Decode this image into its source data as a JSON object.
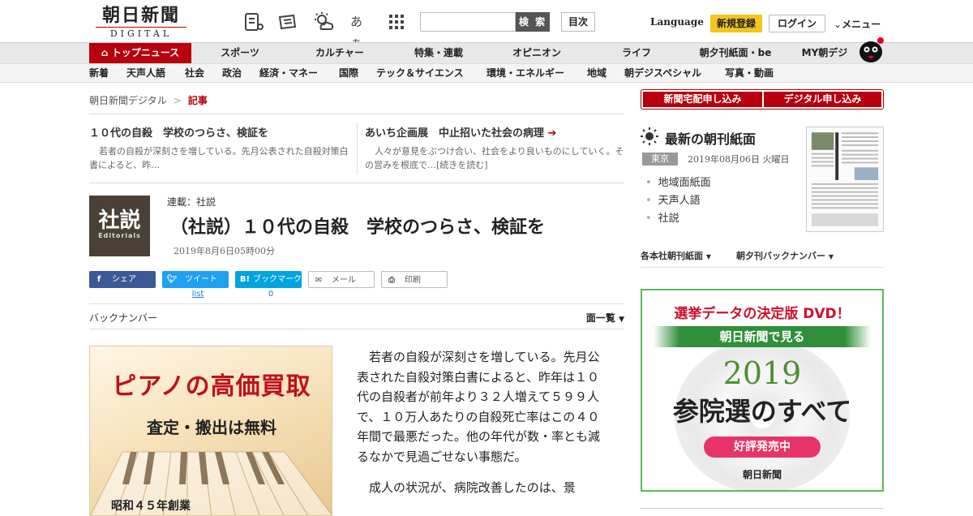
{
  "header": {
    "logo_jp": "朝日新聞",
    "logo_en": "DIGITAL",
    "font_size_label": "あぁ",
    "search_placeholder": "",
    "search_button": "検 索",
    "toc_button": "目次",
    "language": "Language",
    "register": "新規登録",
    "login": "ログイン",
    "menu": "メニュー"
  },
  "nav_primary": [
    {
      "label": "トップニュース",
      "active": true
    },
    {
      "label": "スポーツ"
    },
    {
      "label": "カルチャー"
    },
    {
      "label": "特集・連載"
    },
    {
      "label": "オピニオン"
    },
    {
      "label": "ライフ"
    },
    {
      "label": "朝夕刊紙面・be"
    },
    {
      "label": "MY朝デジ"
    }
  ],
  "nav_secondary": [
    "新着",
    "天声人語",
    "社会",
    "政治",
    "経済・マネー",
    "国際",
    "テック＆サイエンス",
    "環境・エネルギー",
    "地域",
    "朝デジスペシャル",
    "写真・動画"
  ],
  "breadcrumb": {
    "home": "朝日新聞デジタル",
    "sep": ">",
    "current": "記事"
  },
  "related": [
    {
      "title": "１０代の自殺　学校のつらさ、検証を",
      "desc": "若者の自殺が深刻さを増している。先月公表された自殺対策白書によると、昨…"
    },
    {
      "title": "あいち企画展　中止招いた社会の病理",
      "desc": "人々が意見をぶつけ合い、社会をより良いものにしていく。その営みを根底で…[続きを読む]"
    }
  ],
  "article": {
    "editorial_kanji": "社説",
    "editorial_en": "Editorials",
    "series": "連載：社説",
    "title": "（社説）１０代の自殺　学校のつらさ、検証を",
    "date": "2019年8月6日05時00分",
    "body": [
      "若者の自殺が深刻さを増している。先月公表された自殺対策白書によると、昨年は１０代の自殺者が前年より３２人増えて５９９人で、１０万人あたりの自殺死亡率はこの４０年間で最悪だった。他の年代が数・率とも減るなかで見過ごせない事態だ。",
      "成人の状況が、病院改善したのは、景"
    ]
  },
  "share": {
    "facebook": "シェア",
    "twitter": "ツイート",
    "twitter_count": "list",
    "hatena": "ブックマーク",
    "hatena_count": "0",
    "mail": "メール",
    "print": "印刷"
  },
  "backnumber": {
    "label": "バックナンバー",
    "list": "面一覧"
  },
  "ad_piano": {
    "headline": "ピアノの高価買取",
    "sub": "査定・搬出は無料",
    "founded": "昭和４５年創業"
  },
  "sidebar": {
    "subscribe_paper": "新聞宅配申し込み",
    "subscribe_digital": "デジタル申し込み",
    "newspaper_title": "最新の朝刊紙面",
    "region": "東京",
    "date": "2019年08月06日 火曜日",
    "links": [
      "地域面紙面",
      "天声人語",
      "社説"
    ],
    "tab_morning": "各本社朝刊紙面",
    "tab_backnumber": "朝夕刊バックナンバー"
  },
  "ad_dvd": {
    "headline": "選挙データの決定版 DVD！",
    "band": "朝日新聞で見る",
    "year": "2019",
    "title": "参院選のすべて",
    "pill": "好評発売中",
    "brand": "朝日新聞"
  },
  "colors": {
    "brand_red": "#b8000e",
    "register_yellow": "#f4c51e",
    "ad_green": "#5bb95b",
    "pill_pink": "#e8336a"
  }
}
